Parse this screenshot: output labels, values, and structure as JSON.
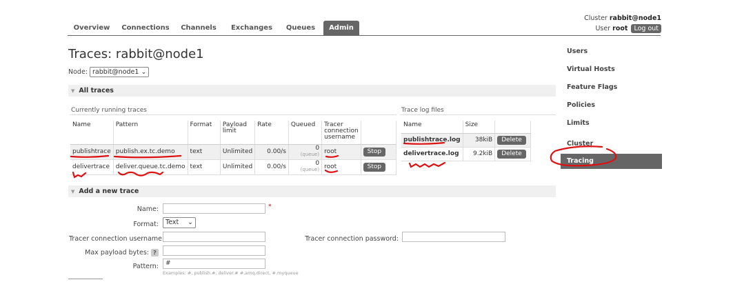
{
  "cluster": {
    "label": "Cluster",
    "name": "rabbit@node1",
    "user_label": "User",
    "user": "root",
    "logout": "Log out"
  },
  "nav": {
    "tabs": [
      {
        "label": "Overview"
      },
      {
        "label": "Connections"
      },
      {
        "label": "Channels"
      },
      {
        "label": "Exchanges"
      },
      {
        "label": "Queues"
      },
      {
        "label": "Admin"
      }
    ]
  },
  "page": {
    "title": "Traces: rabbit@node1",
    "node_label": "Node:",
    "node_value": "rabbit@node1"
  },
  "all_traces": {
    "header": "All traces",
    "running_caption": "Currently running traces",
    "columns": [
      "Name",
      "Pattern",
      "Format",
      "Payload limit",
      "Rate",
      "Queued",
      "Tracer connection username",
      ""
    ],
    "rows": [
      {
        "name": "publishtrace",
        "pattern": "publish.ex.tc.demo",
        "format": "text",
        "payload": "Unlimited",
        "rate": "0.00/s",
        "queued": "0",
        "queued_sub": "(queue)",
        "user": "root",
        "action": "Stop"
      },
      {
        "name": "delivertrace",
        "pattern": "deliver.queue.tc.demo",
        "format": "text",
        "payload": "Unlimited",
        "rate": "0.00/s",
        "queued": "0",
        "queued_sub": "(queue)",
        "user": "root",
        "action": "Stop"
      }
    ],
    "files_caption": "Trace log files",
    "file_columns": [
      "Name",
      "Size",
      ""
    ],
    "files": [
      {
        "name": "publishtrace.log",
        "size": "38kiB",
        "action": "Delete"
      },
      {
        "name": "delivertrace.log",
        "size": "9.2kiB",
        "action": "Delete"
      }
    ]
  },
  "sidebar": {
    "items": [
      {
        "label": "Users"
      },
      {
        "label": "Virtual Hosts"
      },
      {
        "label": "Feature Flags"
      },
      {
        "label": "Policies"
      },
      {
        "label": "Limits"
      },
      {
        "label": "Cluster"
      },
      {
        "label": "Tracing"
      }
    ]
  },
  "add_trace": {
    "header": "Add a new trace",
    "name_label": "Name:",
    "required_mark": "*",
    "format_label": "Format:",
    "format_value": "Text",
    "username_label": "Tracer connection username:",
    "password_label": "Tracer connection password:",
    "max_payload_label": "Max payload bytes:",
    "help": "?",
    "pattern_label": "Pattern:",
    "pattern_value": "#",
    "pattern_examples": "Examples: #, publish.#, deliver.# #.amq.direct, #.myqueue"
  },
  "annotation_color": "#dd1111"
}
